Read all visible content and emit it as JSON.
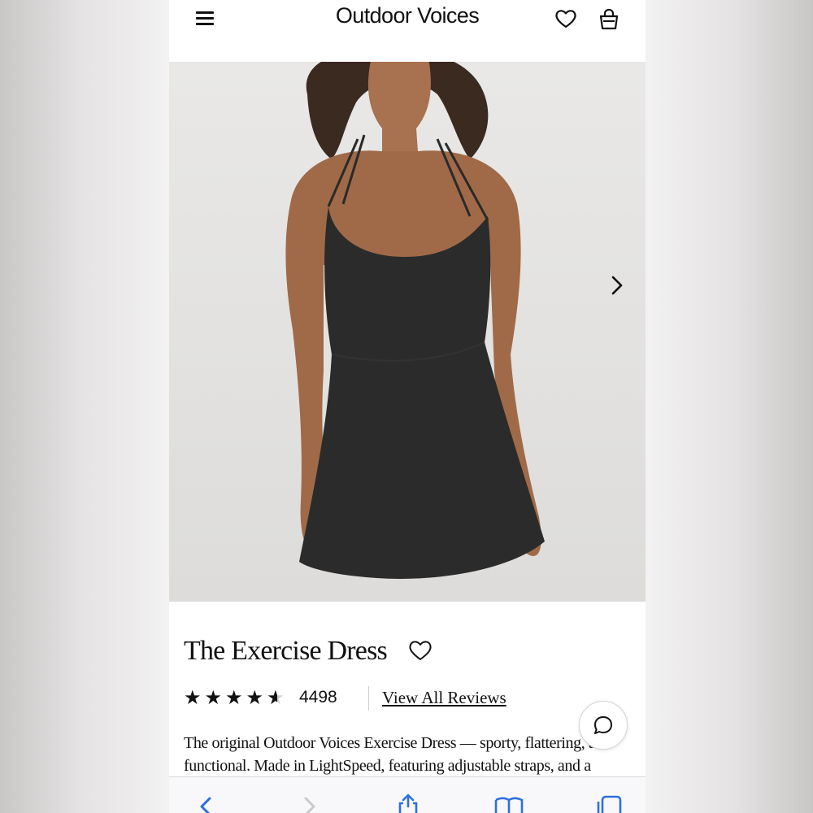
{
  "header": {
    "brand": "Outdoor Voices",
    "menu_icon": "hamburger-menu-icon",
    "wishlist_icon": "heart-icon",
    "bag_icon": "shopping-bag-icon"
  },
  "gallery": {
    "next_icon": "chevron-right-icon"
  },
  "product": {
    "title": "The Exercise Dress",
    "rating": 4.5,
    "review_count": "4498",
    "view_reviews_label": "View All Reviews",
    "description": "The original Outdoor Voices Exercise Dress — sporty, flattering, and functional. Made in LightSpeed, featuring adjustable straps, and a"
  },
  "chat": {
    "icon": "chat-bubble-icon"
  },
  "browser_toolbar": {
    "items": [
      "back-icon",
      "forward-icon",
      "share-icon",
      "bookmarks-icon",
      "tabs-icon"
    ]
  },
  "colors": {
    "text": "#111111",
    "toolbar_icons": "#2f6fe0",
    "background": "#ffffff"
  }
}
